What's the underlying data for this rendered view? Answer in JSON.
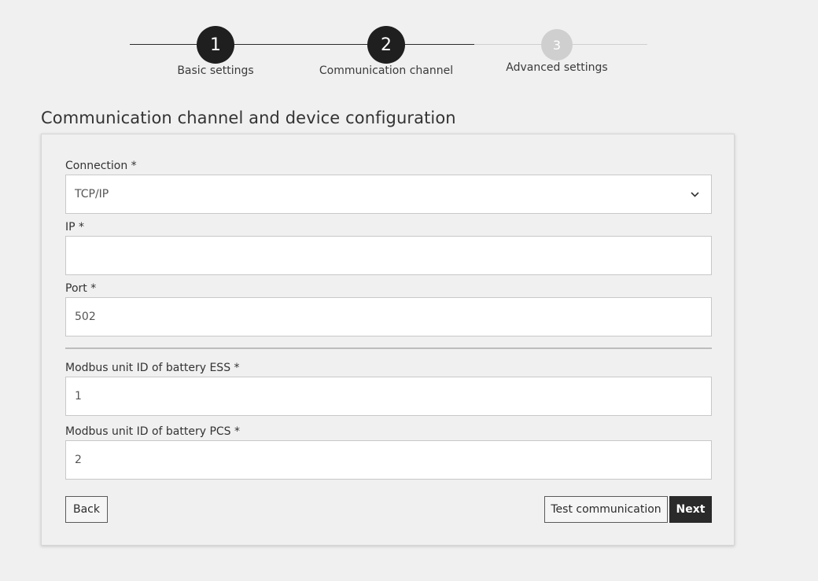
{
  "stepper": {
    "steps": [
      {
        "number": "1",
        "label": "Basic settings",
        "state": "completed"
      },
      {
        "number": "2",
        "label": "Communication channel",
        "state": "current"
      },
      {
        "number": "3",
        "label": "Advanced settings",
        "state": "upcoming"
      }
    ],
    "colors": {
      "active": "#1f1f1f",
      "inactive": "#cfcfcf"
    }
  },
  "page": {
    "title": "Communication channel and device configuration"
  },
  "form": {
    "connection": {
      "label": "Connection *",
      "value": "TCP/IP",
      "icon": "chevron-down-icon"
    },
    "ip": {
      "label": "IP *",
      "value": ""
    },
    "port": {
      "label": "Port *",
      "value": "502"
    },
    "modbus_ess": {
      "label": "Modbus unit ID of battery ESS *",
      "value": "1"
    },
    "modbus_pcs": {
      "label": "Modbus unit ID of battery PCS *",
      "value": "2"
    }
  },
  "buttons": {
    "back": "Back",
    "test": "Test communication",
    "next": "Next"
  }
}
